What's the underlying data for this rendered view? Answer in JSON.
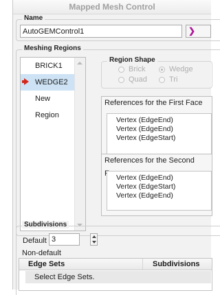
{
  "window": {
    "title": "Mapped Mesh Control"
  },
  "name_group": {
    "label": "Name",
    "value": "AutoGEMControl1"
  },
  "meshing_regions": {
    "label": "Meshing Regions",
    "items": [
      {
        "label": "BRICK1",
        "selected": false
      },
      {
        "label": "WEDGE2",
        "selected": true
      },
      {
        "label": "New Region",
        "selected": false
      }
    ]
  },
  "region_shape": {
    "label": "Region Shape",
    "options": [
      {
        "label": "Brick",
        "checked": false
      },
      {
        "label": "Wedge",
        "checked": true
      },
      {
        "label": "Quad",
        "checked": false
      },
      {
        "label": "Tri",
        "checked": false
      }
    ]
  },
  "references": {
    "first_face": {
      "label": "References for the First Face",
      "items": [
        "Vertex (EdgeEnd)",
        "Vertex (EdgeEnd)",
        "Vertex (EdgeStart)"
      ]
    },
    "second_face": {
      "label": "References for the Second Face",
      "items": [
        "Vertex (EdgeEnd)",
        "Vertex (EdgeStart)",
        "Vertex (EdgeEnd)"
      ]
    }
  },
  "subdivisions": {
    "label": "Subdivisions",
    "default_label": "Default",
    "default_value": "3",
    "nondefault_label": "Non-default",
    "table": {
      "columns": [
        "Edge Sets",
        "Subdivisions"
      ],
      "placeholder": "Select Edge Sets."
    }
  },
  "colors": {
    "selected_row": "#cde3f5",
    "arrow": "#d4271a",
    "accent": "#b0179a"
  }
}
